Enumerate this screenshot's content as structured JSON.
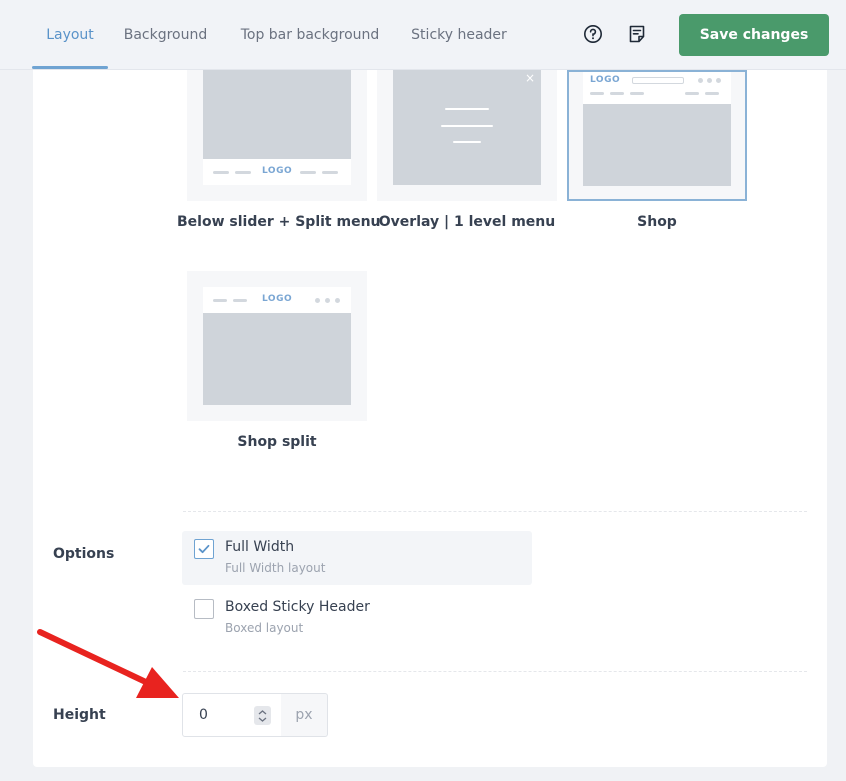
{
  "tabs": [
    {
      "label": "Layout",
      "active": true
    },
    {
      "label": "Background",
      "active": false
    },
    {
      "label": "Top bar background",
      "active": false
    },
    {
      "label": "Sticky header",
      "active": false
    }
  ],
  "toolbar": {
    "help_icon": "question-circle-icon",
    "notes_icon": "notes-icon",
    "save_label": "Save changes"
  },
  "layouts": [
    {
      "label": "Below slider + Split menu",
      "logo": "LOGO",
      "selected": false
    },
    {
      "label": "Overlay | 1 level menu",
      "close": "×",
      "selected": false
    },
    {
      "label": "Shop",
      "logo": "LOGO",
      "selected": true
    },
    {
      "label": "Shop split",
      "logo": "LOGO",
      "selected": false
    }
  ],
  "options": {
    "label": "Options",
    "items": [
      {
        "title": "Full Width",
        "subtitle": "Full Width layout",
        "checked": true
      },
      {
        "title": "Boxed Sticky Header",
        "subtitle": "Boxed layout",
        "checked": false
      }
    ]
  },
  "height": {
    "label": "Height",
    "value": "0",
    "unit": "px"
  },
  "colors": {
    "accent": "#5a93c9",
    "save_button": "#4a9a6b",
    "annotation_arrow": "#e8231f"
  }
}
